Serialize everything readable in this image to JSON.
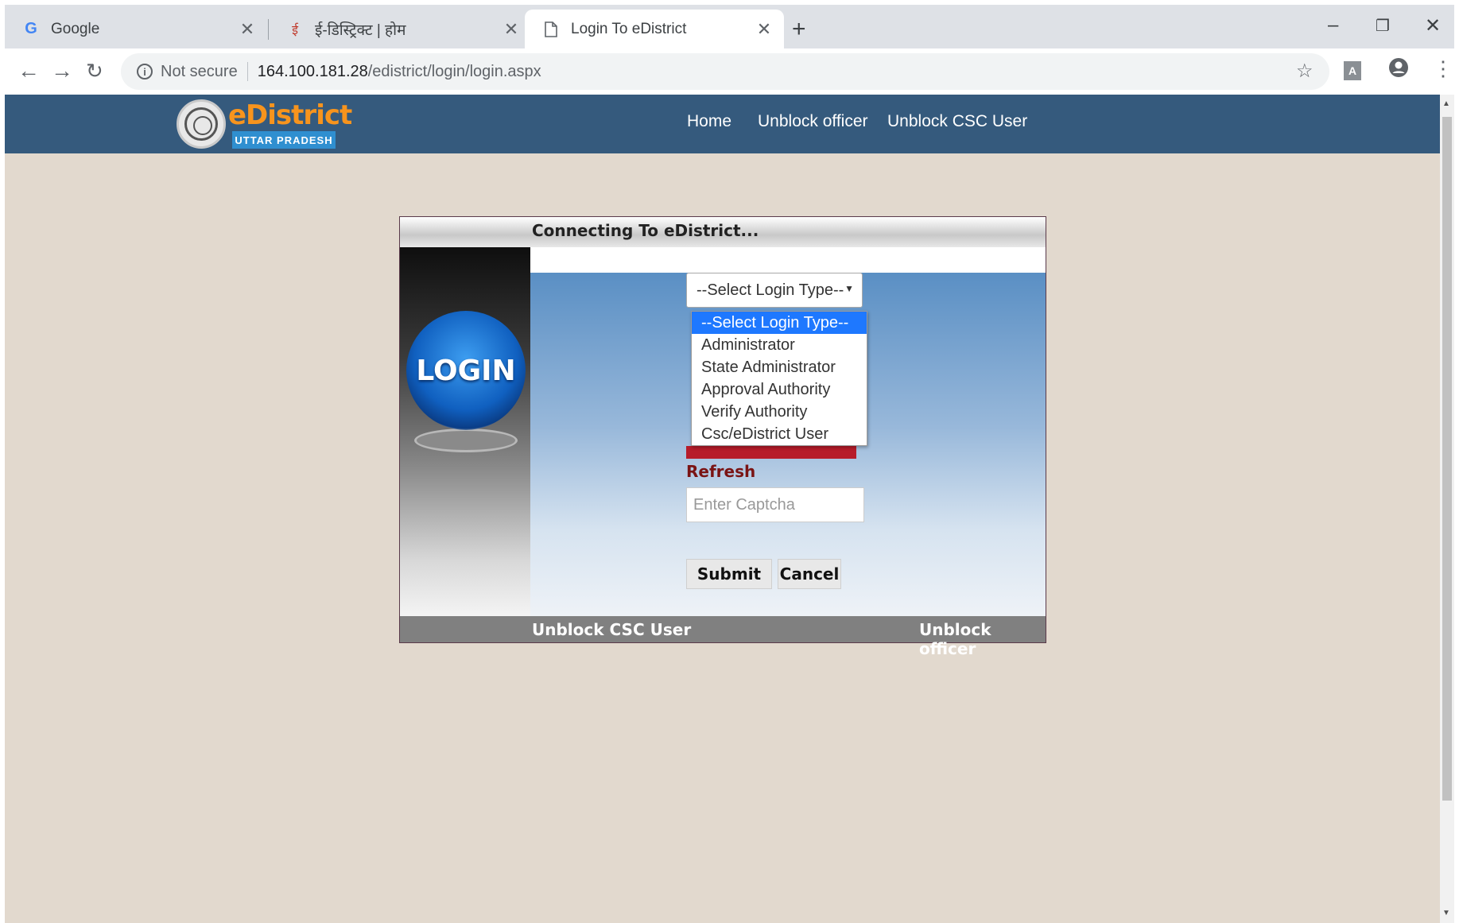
{
  "browser": {
    "tabs": [
      {
        "title": "Google",
        "icon": "google-g-icon"
      },
      {
        "title": "ई-डिस्ट्रिक्ट | होम",
        "icon": "edistrict-favicon-icon"
      },
      {
        "title": "Login To eDistrict",
        "icon": "page-icon"
      }
    ],
    "address": {
      "security": "Not secure",
      "host": "164.100.181.28",
      "path": "/edistrict/login/login.aspx"
    }
  },
  "site": {
    "brand": "eDistrict",
    "state": "UTTAR PRADESH",
    "nav": [
      "Home",
      "Unblock officer",
      "Unblock CSC User"
    ]
  },
  "login": {
    "heading": "Connecting To eDistrict...",
    "orb_label": "LOGIN",
    "login_type_selected": "--Select Login Type--",
    "login_type_options": [
      "--Select Login Type--",
      "Administrator",
      "State Administrator",
      "Approval Authority",
      "Verify Authority",
      "Csc/eDistrict User"
    ],
    "refresh_label": "Refresh",
    "captcha_placeholder": "Enter Captcha",
    "submit_label": "Submit",
    "cancel_label": "Cancel",
    "footer_left": "Unblock CSC User",
    "footer_right": "Unblock officer"
  },
  "colors": {
    "header_bg": "#355a7d",
    "page_bg": "#e2d9ce",
    "brand_orange": "#f7941d",
    "selected_option": "#1e78ff",
    "captcha_bar": "#b71c2a"
  }
}
